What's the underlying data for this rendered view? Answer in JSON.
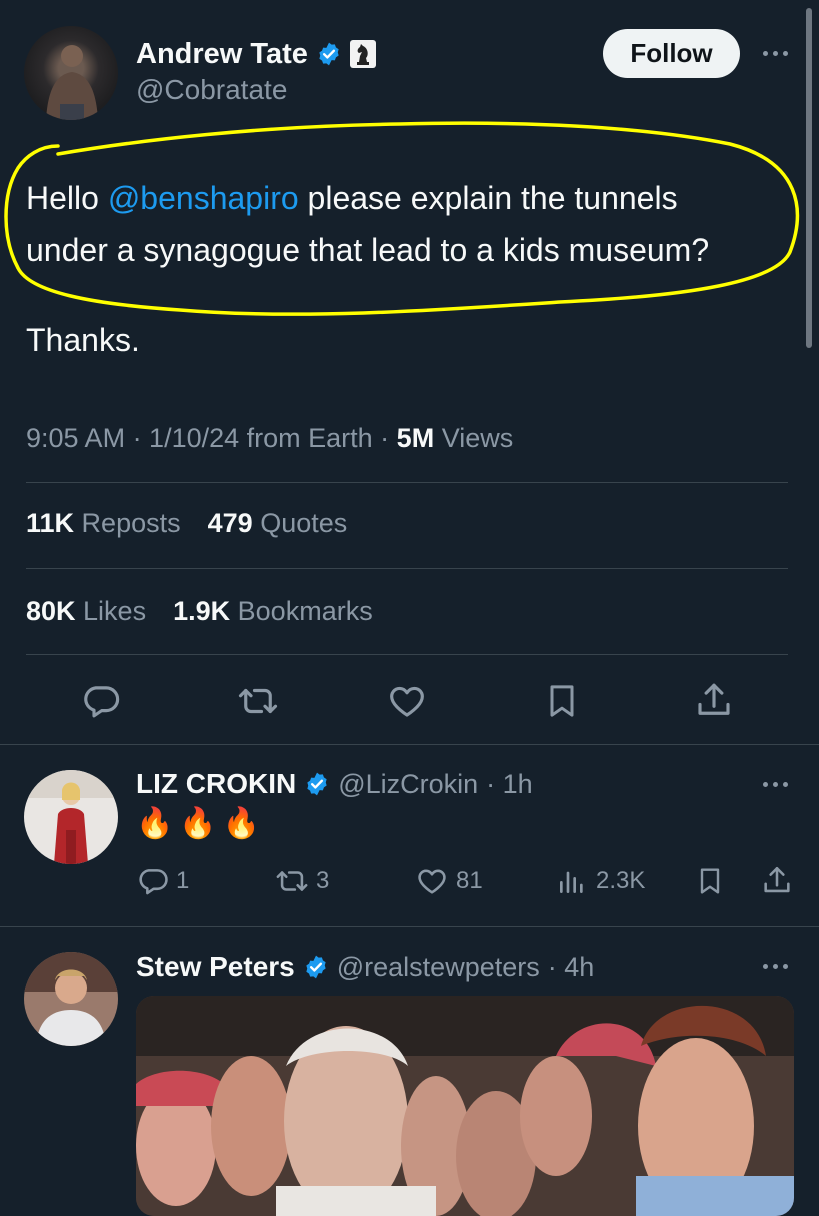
{
  "main_tweet": {
    "author_name": "Andrew Tate",
    "author_handle": "@Cobratate",
    "follow_label": "Follow",
    "text_intro": "Hello ",
    "mention": "@benshapiro",
    "text_line1_rest": " please explain the tunnels",
    "text_line2": "under a synagogue that lead to a kids museum?",
    "text_thanks": "Thanks.",
    "meta_time": "9:05 AM · 1/10/24 from Earth · ",
    "views_count": "5M",
    "views_label": " Views",
    "reposts_count": "11K",
    "reposts_label": " Reposts",
    "quotes_count": "479",
    "quotes_label": " Quotes",
    "likes_count": "80K",
    "likes_label": " Likes",
    "bookmarks_count": "1.9K",
    "bookmarks_label": " Bookmarks"
  },
  "replies": [
    {
      "author_name": "LIZ CROKIN",
      "author_handle": "@LizCrokin",
      "time": "· 1h",
      "text": "🔥🔥🔥",
      "reply_count": "1",
      "repost_count": "3",
      "like_count": "81",
      "view_count": "2.3K"
    },
    {
      "author_name": "Stew Peters",
      "author_handle": "@realstewpeters",
      "time": "· 4h"
    }
  ],
  "colors": {
    "background": "#15202b",
    "accent": "#1d9bf0",
    "muted": "#8b98a5",
    "highlight": "#ffff00"
  }
}
